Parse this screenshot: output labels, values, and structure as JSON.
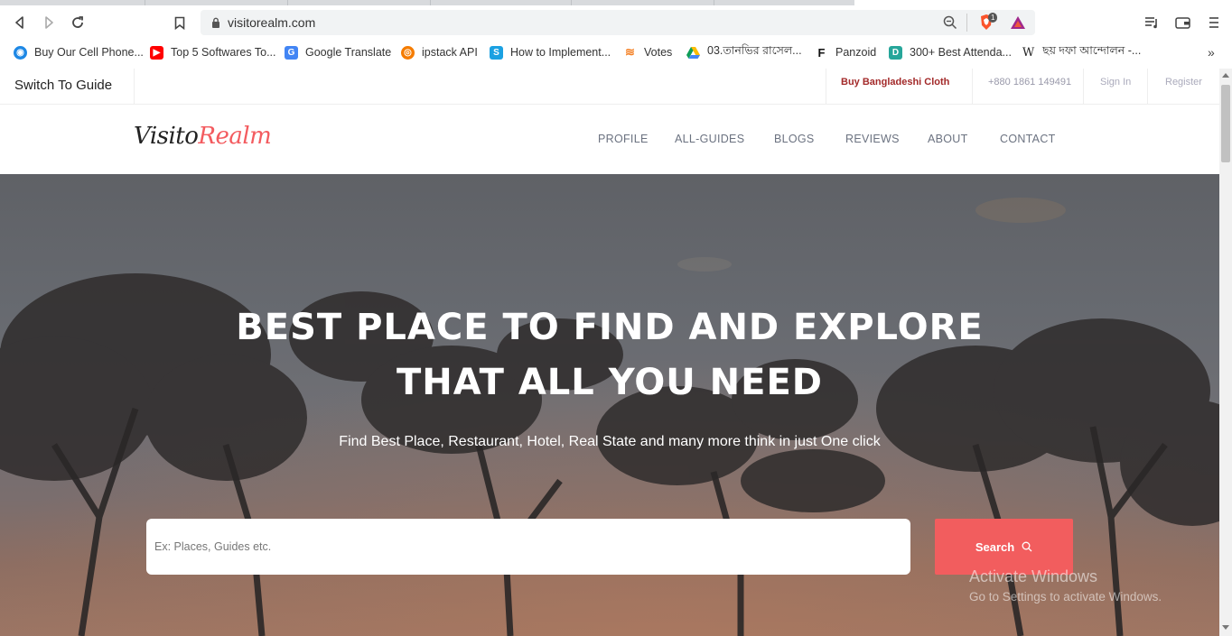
{
  "browser": {
    "url": "visitorealm.com",
    "shield_badge": "1",
    "bookmarks": [
      {
        "label": "Buy Our Cell Phone...",
        "icon": "globe-icon",
        "color": "#1e88e5"
      },
      {
        "label": "Top 5 Softwares To...",
        "icon": "youtube-icon",
        "color": "#ff0000"
      },
      {
        "label": "Google Translate",
        "icon": "translate-icon",
        "color": "#4285f4"
      },
      {
        "label": "ipstack API",
        "icon": "ipstack-icon",
        "color": "#f57c00"
      },
      {
        "label": "How to Implement...",
        "icon": "s-icon",
        "color": "#1ba1e2"
      },
      {
        "label": "Votes",
        "icon": "stackoverflow-icon",
        "color": "#f48024"
      },
      {
        "label": "03.তানভির রাসেল...",
        "icon": "drive-icon",
        "color": "#0f9d58"
      },
      {
        "label": "Panzoid",
        "icon": "panzoid-icon",
        "color": "#111111"
      },
      {
        "label": "300+ Best Attenda...",
        "icon": "d-icon",
        "color": "#26a69a"
      },
      {
        "label": "ছয় দফা আন্দোলন -...",
        "icon": "wikipedia-icon",
        "color": "#333333"
      }
    ]
  },
  "topbar": {
    "switch_label": "Switch To Guide",
    "buy_label": "Buy Bangladeshi Cloth",
    "phone": "+880 1861 149491",
    "signin": "Sign In",
    "register": "Register"
  },
  "navbar": {
    "logo_black": "Visito",
    "logo_red": "Realm",
    "links": [
      "PROFILE",
      "ALL-GUIDES",
      "BLOGS",
      "REVIEWS",
      "ABOUT",
      "CONTACT"
    ]
  },
  "hero": {
    "title_line1": "BEST PLACE TO FIND AND EXPLORE",
    "title_line2": "THAT ALL YOU NEED",
    "subtitle": "Find Best Place, Restaurant, Hotel, Real State and many more think in just One click",
    "search_placeholder": "Ex: Places, Guides etc.",
    "search_button": "Search"
  },
  "watermark": {
    "line1": "Activate Windows",
    "line2": "Go to Settings to activate Windows."
  },
  "colors": {
    "accent": "#f25d5e",
    "buy_link": "#a32a2a"
  }
}
